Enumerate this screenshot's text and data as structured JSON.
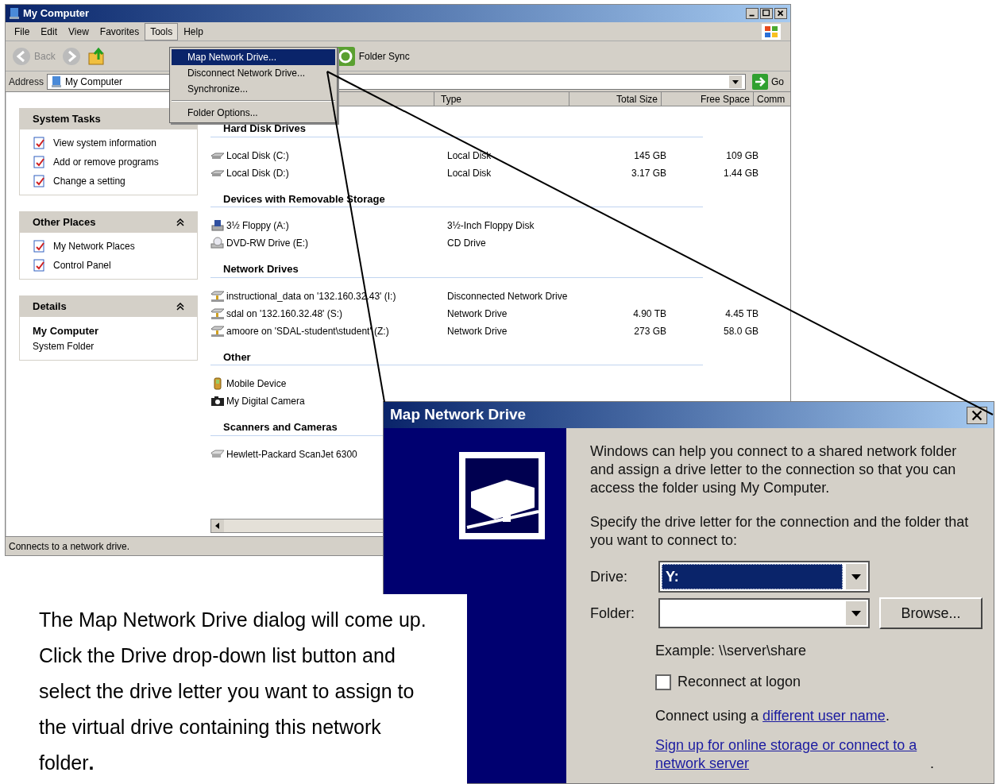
{
  "explorer": {
    "title": "My Computer",
    "menu": [
      {
        "label": "File",
        "selected": false
      },
      {
        "label": "Edit",
        "selected": false
      },
      {
        "label": "View",
        "selected": false
      },
      {
        "label": "Favorites",
        "selected": false
      },
      {
        "label": "Tools",
        "selected": true
      },
      {
        "label": "Help",
        "selected": false
      }
    ],
    "tools_menu": [
      {
        "label": "Map Network Drive...",
        "selected": true
      },
      {
        "label": "Disconnect Network Drive...",
        "selected": false
      },
      {
        "label": "Synchronize...",
        "selected": false
      },
      {
        "label": "Folder Options...",
        "selected": false,
        "separator_before": true
      }
    ],
    "toolbar": {
      "back": "Back",
      "folder_sync": "Folder Sync"
    },
    "address": {
      "label": "Address",
      "value": "My Computer",
      "go": "Go"
    },
    "columns": [
      "Type",
      "Total Size",
      "Free Space",
      "Comm"
    ],
    "panels": [
      {
        "title": "System Tasks",
        "items": [
          "View system information",
          "Add or remove programs",
          "Change a setting"
        ]
      },
      {
        "title": "Other Places",
        "items": [
          "My Network Places",
          "Control Panel"
        ]
      }
    ],
    "details": {
      "title": "Details",
      "name": "My Computer",
      "subtitle": "System Folder"
    },
    "groups": [
      {
        "title": "Hard Disk Drives",
        "items": [
          {
            "kind": "disk",
            "name": "Local Disk (C:)",
            "type": "Local Disk",
            "total": "145 GB",
            "free": "109 GB"
          },
          {
            "kind": "disk",
            "name": "Local Disk (D:)",
            "type": "Local Disk",
            "total": "3.17 GB",
            "free": "1.44 GB"
          }
        ]
      },
      {
        "title": "Devices with Removable Storage",
        "items": [
          {
            "kind": "floppy",
            "name": "3½ Floppy (A:)",
            "type": "3½-Inch Floppy Disk"
          },
          {
            "kind": "dvd",
            "name": "DVD-RW Drive (E:)",
            "type": "CD Drive"
          }
        ]
      },
      {
        "title": "Network Drives",
        "items": [
          {
            "kind": "network",
            "name": "instructional_data on '132.160.32.43' (I:)",
            "type": "Disconnected Network Drive"
          },
          {
            "kind": "network",
            "name": "sdal on '132.160.32.48' (S:)",
            "type": "Network Drive",
            "total": "4.90 TB",
            "free": "4.45 TB"
          },
          {
            "kind": "network",
            "name": "amoore on 'SDAL-student\\student' (Z:)",
            "type": "Network Drive",
            "total": "273 GB",
            "free": "58.0 GB"
          }
        ]
      },
      {
        "title": "Other",
        "items": [
          {
            "kind": "mobile",
            "name": "Mobile Device"
          },
          {
            "kind": "camera",
            "name": "My Digital Camera"
          }
        ]
      },
      {
        "title": "Scanners and Cameras",
        "items": [
          {
            "kind": "scanner",
            "name": "Hewlett-Packard ScanJet 6300"
          }
        ]
      }
    ],
    "status": "Connects to a network drive."
  },
  "dialog": {
    "title": "Map Network Drive",
    "intro": "Windows can help you connect to a shared network folder and assign a drive letter to the connection so that you can access the folder using My Computer.",
    "specify": "Specify the drive letter for the connection and the folder that you want to connect to:",
    "drive_label": "Drive:",
    "drive_value": "Y:",
    "folder_label": "Folder:",
    "browse": "Browse...",
    "example": "Example: \\\\server\\share",
    "reconnect": {
      "label": "Reconnect at logon",
      "checked": false
    },
    "connect_prefix": "Connect using a",
    "connect_link": "different user name",
    "connect_suffix": ".",
    "signup_link": "Sign up for online storage or connect to a network server",
    "signup_suffix": "."
  },
  "callout": "The Map Network Drive dialog will come up.  Click the Drive drop-down list button and select the drive letter you want to assign to the virtual drive containing this network folder**.**"
}
